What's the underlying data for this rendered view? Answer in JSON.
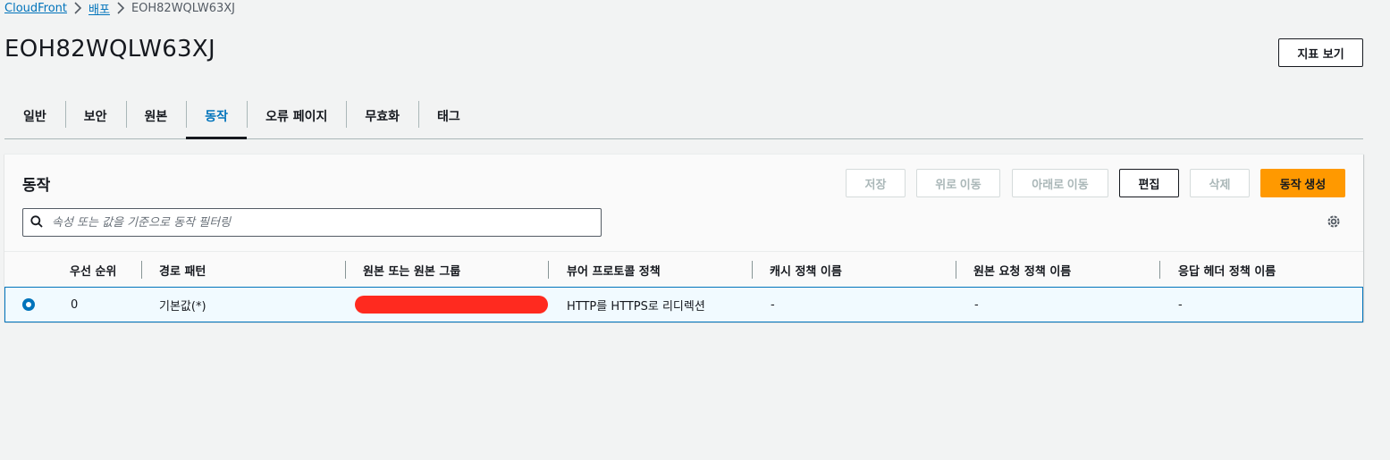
{
  "breadcrumb": {
    "items": [
      "CloudFront",
      "배포"
    ],
    "current": "EOH82WQLW63XJ"
  },
  "page": {
    "title": "EOH82WQLW63XJ",
    "metrics_button": "지표 보기"
  },
  "tabs": [
    {
      "label": "일반",
      "active": false
    },
    {
      "label": "보안",
      "active": false
    },
    {
      "label": "원본",
      "active": false
    },
    {
      "label": "동작",
      "active": true
    },
    {
      "label": "오류 페이지",
      "active": false
    },
    {
      "label": "무효화",
      "active": false
    },
    {
      "label": "태그",
      "active": false
    }
  ],
  "panel": {
    "title": "동작",
    "buttons": {
      "save": "저장",
      "move_up": "위로 이동",
      "move_down": "아래로 이동",
      "edit": "편집",
      "delete": "삭제",
      "create": "동작 생성"
    },
    "search_placeholder": "속성 또는 값을 기준으로 동작 필터링"
  },
  "table": {
    "headers": [
      "우선 순위",
      "경로 패턴",
      "원본 또는 원본 그룹",
      "뷰어 프로토콜 정책",
      "캐시 정책 이름",
      "원본 요청 정책 이름",
      "응답 헤더 정책 이름"
    ],
    "rows": [
      {
        "selected": true,
        "priority": "0",
        "path": "기본값(*)",
        "origin": "",
        "viewer_policy": "HTTP를 HTTPS로 리디렉션",
        "cache_policy": "-",
        "origin_request_policy": "-",
        "response_headers_policy": "-"
      }
    ]
  },
  "colors": {
    "accent": "#0073bb",
    "primary_button": "#ff9900",
    "redaction": "#ff2a1f"
  }
}
